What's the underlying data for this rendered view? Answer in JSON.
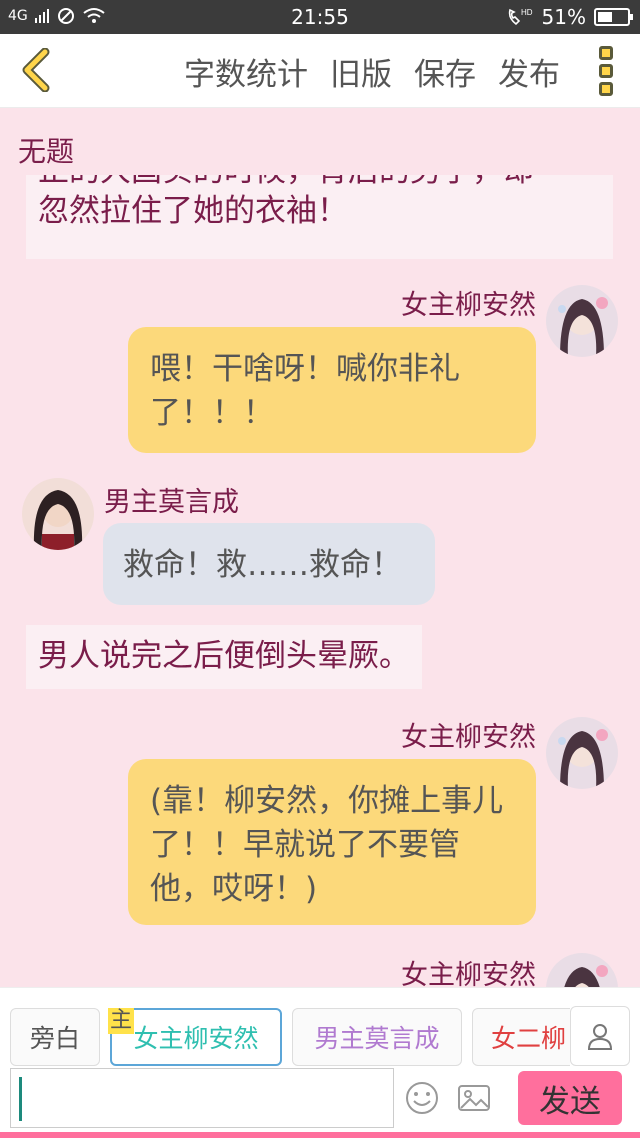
{
  "status": {
    "network": "4G",
    "time": "21:55",
    "battery": "51%",
    "battery_level": 0.51
  },
  "header": {
    "back_icon": "chevron-left-icon",
    "actions": [
      "字数统计",
      "旧版",
      "保存",
      "发布"
    ],
    "menu_icon": "more-vertical-icon"
  },
  "doc": {
    "title": "无题"
  },
  "chat": {
    "narration_top_partial": "正的大国实的时候，背后的男子，却",
    "narration_top": "忽然拉住了她的衣袖！",
    "msg1": {
      "speaker": "女主柳安然",
      "text": "喂！干啥呀！喊你非礼了！！！"
    },
    "msg2": {
      "speaker": "男主莫言成",
      "text": "救命！救……救命！"
    },
    "narration2": "男人说完之后便倒头晕厥。",
    "msg3": {
      "speaker": "女主柳安然",
      "text": "(靠！柳安然，你摊上事儿了！！早就说了不要管他，哎呀！)"
    },
    "msg4": {
      "speaker": "女主柳安然"
    }
  },
  "bottom": {
    "roles": [
      "旁白",
      "女主柳安然",
      "男主莫言成",
      "女二柳"
    ],
    "active_highlight": "主",
    "role_colors": [
      "#555555",
      "#2fbfb0",
      "#b07ad0",
      "#e04040"
    ],
    "send_label": "发送",
    "person_icon": "person-icon",
    "emoji_icon": "emoji-icon",
    "image_icon": "image-icon"
  }
}
